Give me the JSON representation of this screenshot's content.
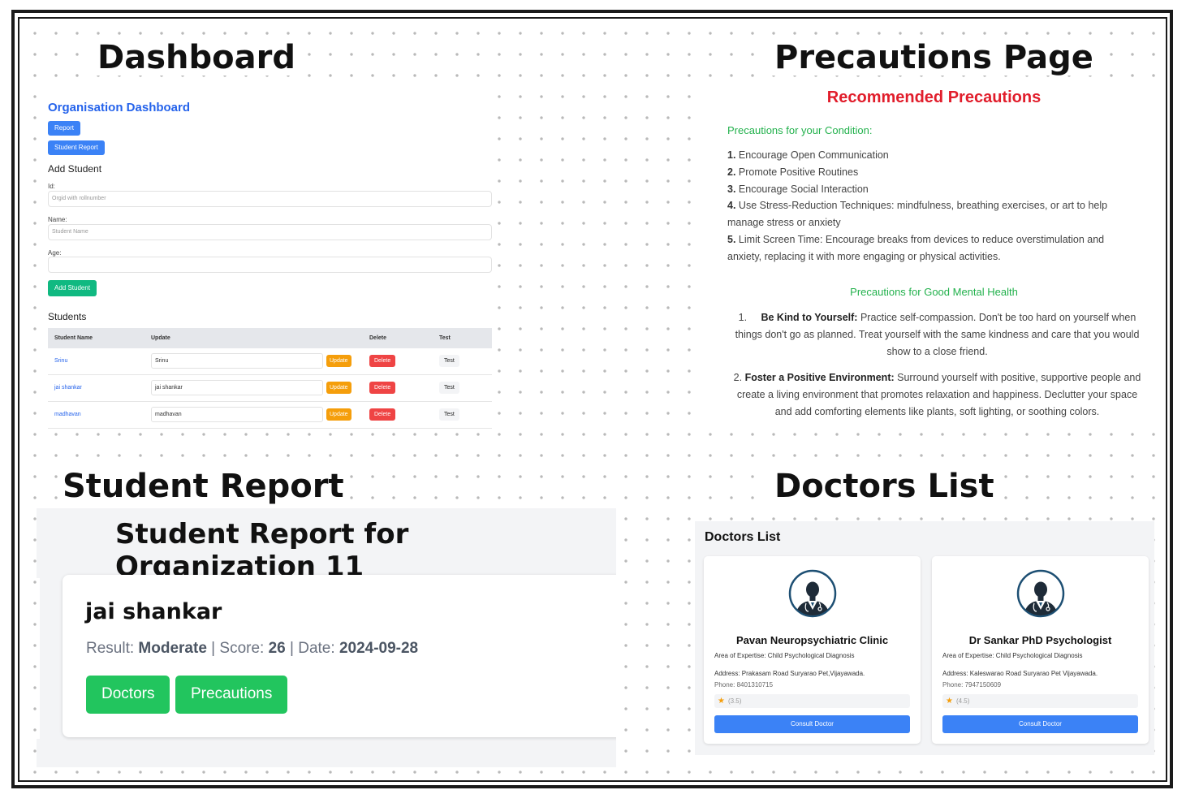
{
  "section_titles": {
    "dashboard": "Dashboard",
    "precautions": "Precautions Page",
    "student_report": "Student Report",
    "doctors": "Doctors List"
  },
  "dashboard": {
    "title": "Organisation Dashboard",
    "report_button": "Report",
    "student_report_button": "Student Report",
    "add_heading": "Add Student",
    "id_label": "Id:",
    "id_placeholder": "Orgid with rollnumber",
    "name_label": "Name:",
    "name_placeholder": "Student Name",
    "age_label": "Age:",
    "age_placeholder": "",
    "add_button": "Add Student",
    "students_heading": "Students",
    "columns": [
      "Student Name",
      "Update",
      "Delete",
      "Test"
    ],
    "rows": [
      {
        "name": "Srinu",
        "value": "Srinu",
        "update": "Update",
        "delete": "Delete",
        "test": "Test"
      },
      {
        "name": "jai shankar",
        "value": "jai shankar",
        "update": "Update",
        "delete": "Delete",
        "test": "Test"
      },
      {
        "name": "madhavan",
        "value": "madhavan",
        "update": "Update",
        "delete": "Delete",
        "test": "Test"
      }
    ]
  },
  "precautions": {
    "title": "Recommended Precautions",
    "condition_heading": "Precautions for your Condition:",
    "condition_items": [
      {
        "num": "1.",
        "text": "Encourage Open Communication"
      },
      {
        "num": "2.",
        "text": "Promote Positive Routines"
      },
      {
        "num": "3.",
        "text": "Encourage Social Interaction"
      },
      {
        "num": "4.",
        "text": "Use Stress-Reduction Techniques: mindfulness, breathing exercises, or art to help manage stress or anxiety"
      },
      {
        "num": "5.",
        "text": "Limit Screen Time: Encourage breaks from devices to reduce overstimulation and anxiety, replacing it with more engaging or physical activities."
      }
    ],
    "mental_heading": "Precautions for Good Mental Health",
    "mental_items": [
      {
        "num": "1.",
        "title": "Be Kind to Yourself:",
        "text": "Practice self-compassion. Don't be too hard on yourself when things don't go as planned. Treat yourself with the same kindness and care that you would show to a close friend."
      },
      {
        "num": "2.",
        "title": "Foster a Positive Environment:",
        "text": "Surround yourself with positive, supportive people and create a living environment that promotes relaxation and happiness. Declutter your space and add comforting elements like plants, soft lighting, or soothing colors."
      }
    ]
  },
  "student_report": {
    "title": "Student Report for Organization 11",
    "student_name": "jai shankar",
    "result_label": "Result:",
    "result_value": "Moderate",
    "score_label": "Score:",
    "score_value": "26",
    "date_label": "Date:",
    "date_value": "2024-09-28",
    "separator": "|",
    "doctors_button": "Doctors",
    "precautions_button": "Precautions"
  },
  "doctors": {
    "title": "Doctors List",
    "list": [
      {
        "name": "Pavan Neuropsychiatric Clinic",
        "expertise": "Area of Expertise: Child Psychological Diagnosis",
        "address": "Address: Prakasam Road Suryarao Pet,Vijayawada.",
        "phone": "Phone: 8401310715",
        "rating": "(3.5)",
        "button": "Consult Doctor"
      },
      {
        "name": "Dr Sankar PhD Psychologist",
        "expertise": "Area of Expertise: Child Psychological Diagnosis",
        "address": "Address: Kaleswarao Road Suryarao Pet Vijayawada.",
        "phone": "Phone: 7947150609",
        "rating": "(4.5)",
        "button": "Consult Doctor"
      }
    ]
  },
  "icons": {
    "star": "star-icon",
    "doctor_avatar": "doctor-avatar-icon"
  },
  "colors": {
    "primary_blue": "#3b82f6",
    "success_green": "#22c55e",
    "danger_red": "#ef4444",
    "warning_amber": "#f59e0b",
    "heading_red": "#e11d2b",
    "heading_green": "#22b14c"
  }
}
